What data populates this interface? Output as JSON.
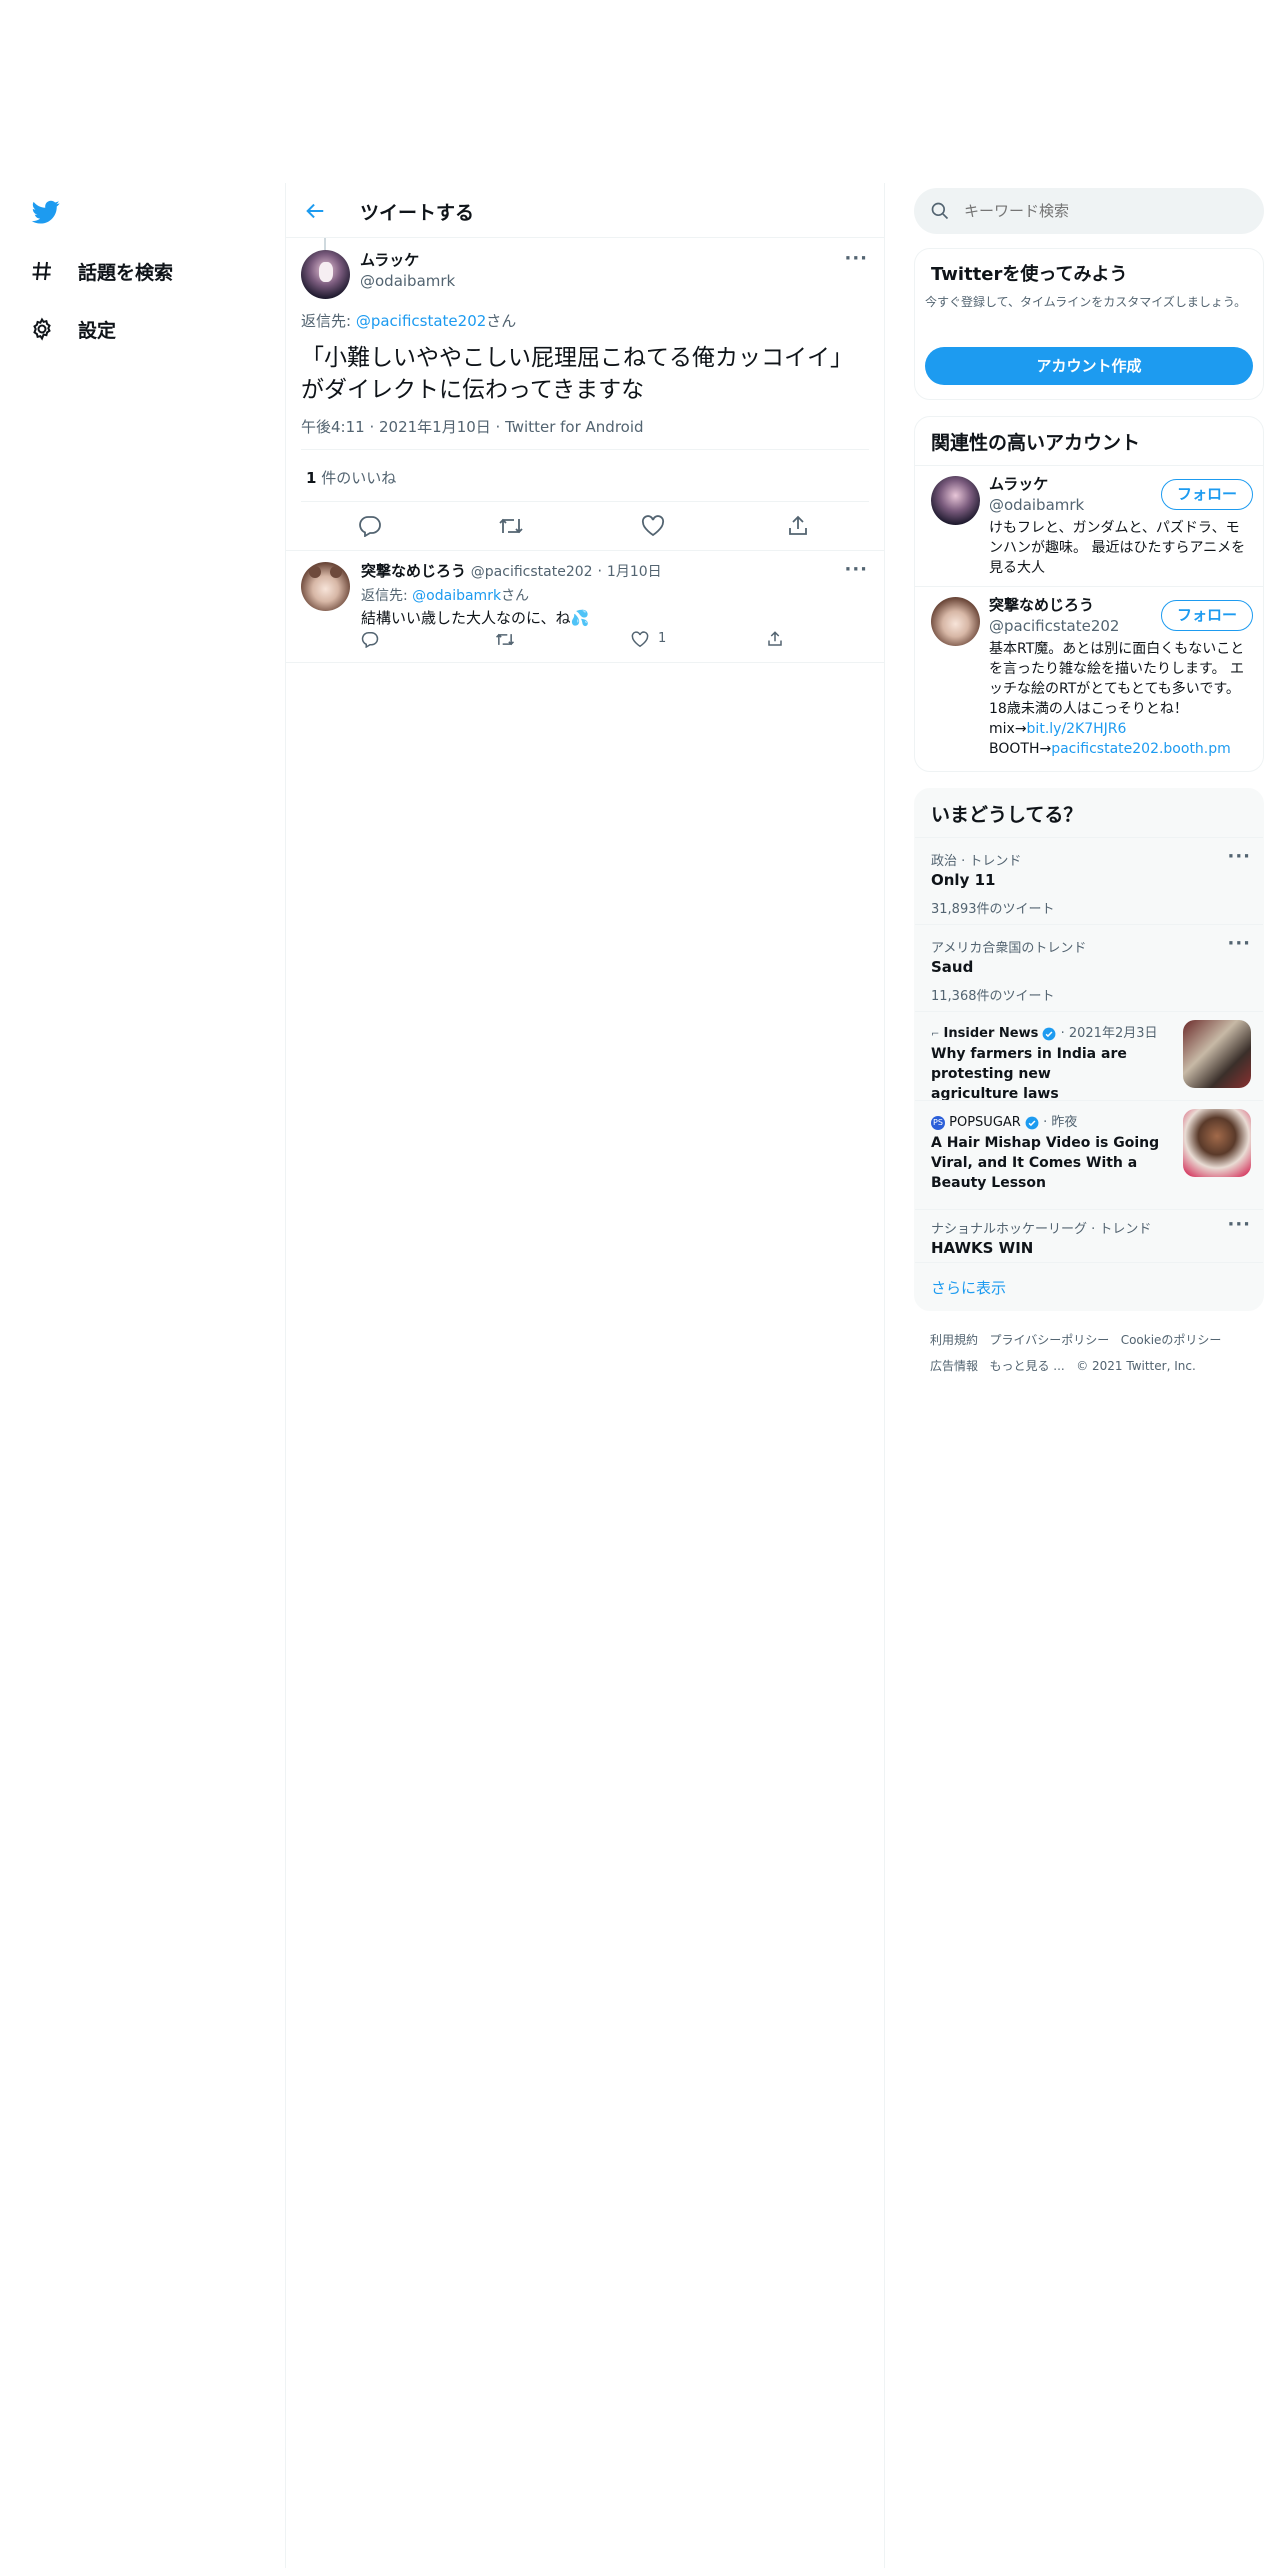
{
  "nav": {
    "items": [
      {
        "label": "話題を検索"
      },
      {
        "label": "設定"
      }
    ]
  },
  "header": {
    "title": "ツイートする"
  },
  "tweet": {
    "name": "ムラッケ",
    "handle": "@odaibamrk",
    "reply_prefix": "返信先: ",
    "reply_to": "@pacificstate202",
    "reply_suffix": "さん",
    "text": "「小難しいややこしい屁理屈こねてる俺カッコイイ」がダイレクトに伝わってきますな",
    "meta": "午後4:11 · 2021年1月10日 · Twitter for Android",
    "likes_count": "1",
    "likes_label": " 件のいいね"
  },
  "reply": {
    "name": "突撃なめじろう",
    "handle": "@pacificstate202",
    "sep": "·",
    "date": "1月10日",
    "reply_prefix": "返信先: ",
    "reply_to": "@odaibamrk",
    "reply_suffix": "さん",
    "text": "結構いい歳した大人なのに、ね💦",
    "like_count": "1"
  },
  "search": {
    "placeholder": "キーワード検索"
  },
  "signup": {
    "title": "Twitterを使ってみよう",
    "desc": "今すぐ登録して、タイムラインをカスタマイズしましょう。",
    "button": "アカウント作成"
  },
  "related": {
    "title": "関連性の高いアカウント",
    "accounts": [
      {
        "name": "ムラッケ",
        "handle": "@odaibamrk",
        "follow": "フォロー",
        "bio": "けもフレと、ガンダムと、パズドラ、モンハンが趣味。 最近はひたすらアニメを見る大人"
      },
      {
        "name": "突撃なめじろう",
        "handle": "@pacificstate202",
        "follow": "フォロー",
        "bio1": "基本RT魔。あとは別に面白くもないことを言ったり雑な絵を描いたりします。 エッチな絵のRTがとてもとても多いです。18歳未満の人はこっそりとね！ mix→",
        "bio_link1": "bit.ly/2K7HJR6",
        "bio2": "BOOTH→",
        "bio_link2": "pacificstate202.booth.pm"
      }
    ]
  },
  "trends": {
    "title": "いまどうしてる？",
    "items": [
      {
        "context": "政治 · トレンド",
        "name": "Only 11",
        "count": "31,893件のツイート"
      },
      {
        "context": "アメリカ合衆国のトレンド",
        "name": "Saud",
        "count": "11,368件のツイート"
      },
      {
        "source": "Insider News",
        "date": "· 2021年2月3日",
        "headline": "Why farmers in India are protesting new agriculture laws"
      },
      {
        "source": "POPSUGAR",
        "date": "· 昨夜",
        "headline": "A Hair Mishap Video is Going Viral, and It Comes With a Beauty Lesson"
      },
      {
        "context": "ナショナルホッケーリーグ · トレンド",
        "name": "HAWKS WIN"
      }
    ],
    "more": "さらに表示"
  },
  "footer": {
    "links": [
      "利用規約",
      "プライバシーポリシー",
      "Cookieのポリシー",
      "広告情報",
      "もっと見る ...",
      "© 2021 Twitter, Inc."
    ]
  },
  "colors": {
    "accent": "#1d9bf0",
    "text": "#0f1419",
    "muted": "#536471"
  },
  "icons": [
    "twitter-logo-icon",
    "hashtag-icon",
    "gear-icon",
    "back-arrow-icon",
    "more-icon",
    "reply-icon",
    "retweet-icon",
    "like-icon",
    "share-icon",
    "search-icon",
    "verified-icon"
  ]
}
